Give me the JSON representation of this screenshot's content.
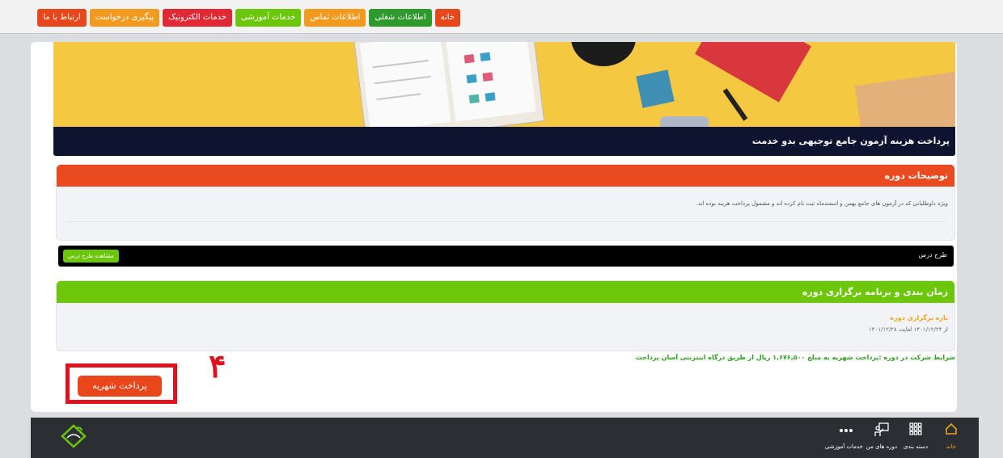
{
  "nav": {
    "items": [
      {
        "label": "خانه",
        "color": "#e8461b"
      },
      {
        "label": "اطلاعات شغلی",
        "color": "#2e9a2b"
      },
      {
        "label": "اطلاعات تماس",
        "color": "#f29a1f"
      },
      {
        "label": "خدمات آموزشی",
        "color": "#6cc60a"
      },
      {
        "label": "خدمات الکترونیک",
        "color": "#e02934"
      },
      {
        "label": "پیگیری درخواست",
        "color": "#f29a1f"
      },
      {
        "label": "ارتباط با ما",
        "color": "#e8461b"
      }
    ]
  },
  "course": {
    "title": "پرداخت هزینه آزمون جامع توجیهی بدو خدمت"
  },
  "description": {
    "header": "توضیحات دوره",
    "text": "ویژه داوطلبانی که در آزمون های جامع بهمن و اسفندماه ثبت نام کرده اند و مشمول پرداخت هزینه بوده اند.",
    "header_color": "#ea4a1f"
  },
  "plan": {
    "label": "طرح درس",
    "button": "مشاهده طرح درس"
  },
  "schedule": {
    "header": "زمان بندی و برنامه برگزاری دوره",
    "header_color": "#6cc60a",
    "period_label": "بازه برگزاری دوره",
    "period_value": "از ۱۴۰۱/۱۲/۲۴ لغایت ۱۴۰۱/۱۲/۲۸"
  },
  "terms": "شرایط شرکت در دوره :پرداخت شهریه به مبلغ ۱,۶۷۶,۵۰۰ ریال از طریق درگاه اینترنتی آسان پرداخت",
  "pay_button": "پرداخت شهریه",
  "annotation_number": "۴",
  "bottom_nav": {
    "home": "خانه",
    "categories": "دسته بندی",
    "my_courses": "دوره های من",
    "services": "خدمات آموزشی"
  },
  "icons": {
    "home": "home-icon",
    "categories": "grid-icon",
    "my_courses": "teacher-board-icon",
    "services": "more-dots-icon",
    "logo": "brand-logo"
  }
}
